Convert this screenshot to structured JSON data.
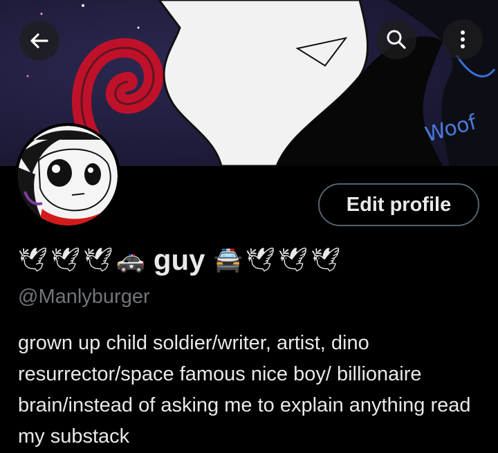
{
  "header": {
    "back_icon": "arrow-left-icon",
    "search_icon": "search-icon",
    "more_icon": "more-vertical-icon",
    "banner_text": "Woof"
  },
  "profile": {
    "edit_label": "Edit profile",
    "name_prefix_emojis": [
      "🕊",
      "🕊",
      "🕊",
      "🚓"
    ],
    "display_name": "guy",
    "name_suffix_emojis": [
      "🚔",
      "🕊",
      "🕊",
      "🕊"
    ],
    "handle": "@Manlyburger",
    "bio": "grown up child soldier/writer, artist, dino resurrector/space famous nice boy/ billionaire brain/instead of asking me to explain anything read my substack"
  },
  "colors": {
    "background": "#000000",
    "text": "#e7e9ea",
    "muted": "#71767b",
    "border": "#536471"
  }
}
